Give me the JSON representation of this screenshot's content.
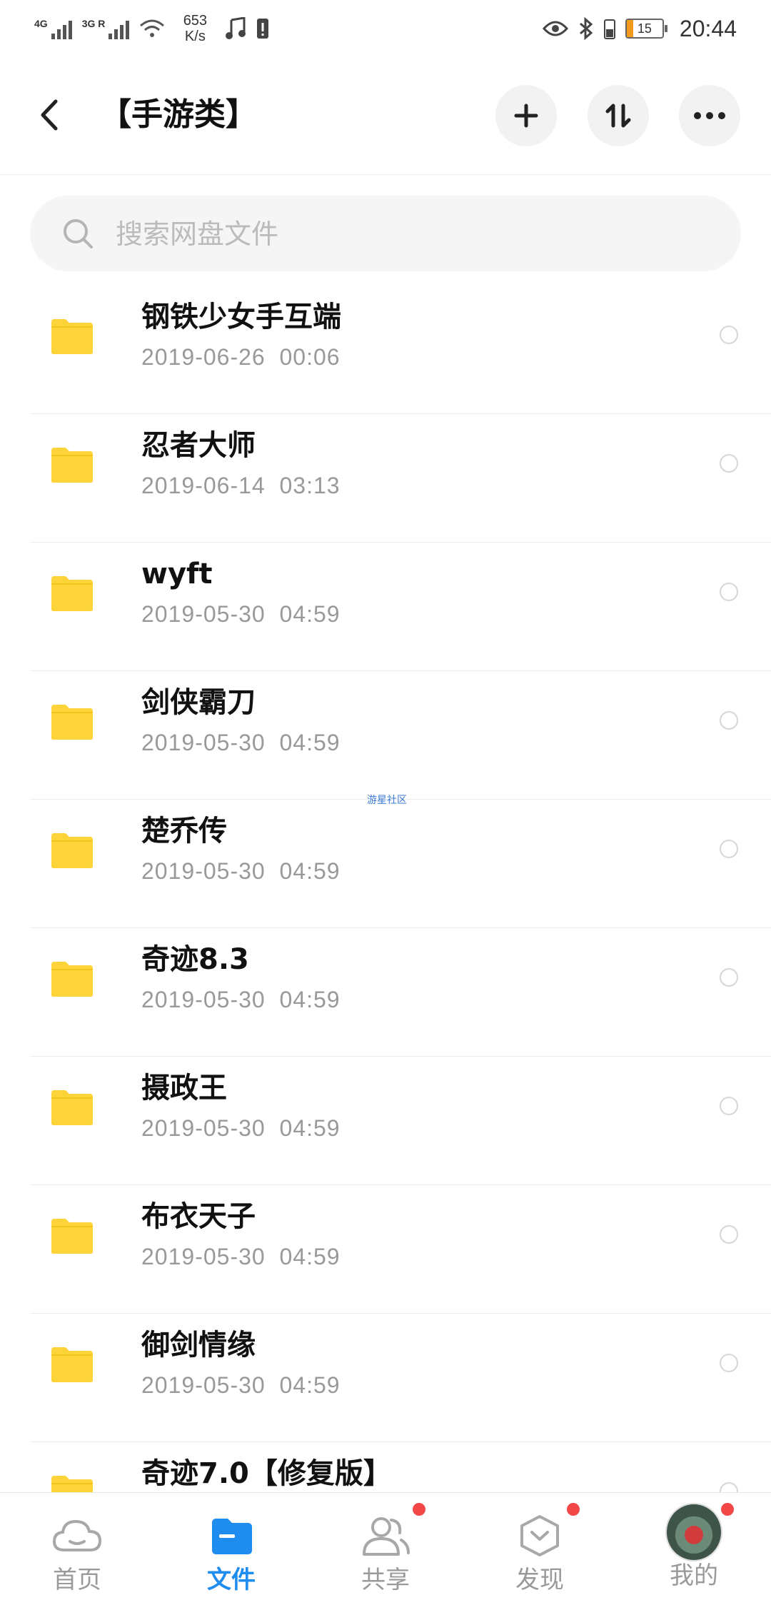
{
  "status_bar": {
    "net1": "4G",
    "net2": "3G R",
    "speed_value": "653",
    "speed_unit": "K/s",
    "battery_level": "15",
    "time": "20:44"
  },
  "header": {
    "title": "【手游类】"
  },
  "search": {
    "placeholder": "搜索网盘文件"
  },
  "files": [
    {
      "name": "钢铁少女手互端",
      "date": "2019-06-26",
      "time": "00:06"
    },
    {
      "name": "忍者大师",
      "date": "2019-06-14",
      "time": "03:13"
    },
    {
      "name": "wyft",
      "date": "2019-05-30",
      "time": "04:59"
    },
    {
      "name": "剑侠霸刀",
      "date": "2019-05-30",
      "time": "04:59"
    },
    {
      "name": "楚乔传",
      "date": "2019-05-30",
      "time": "04:59"
    },
    {
      "name": "奇迹8.3",
      "date": "2019-05-30",
      "time": "04:59"
    },
    {
      "name": "摄政王",
      "date": "2019-05-30",
      "time": "04:59"
    },
    {
      "name": "布衣天子",
      "date": "2019-05-30",
      "time": "04:59"
    },
    {
      "name": "御剑情缘",
      "date": "2019-05-30",
      "time": "04:59"
    },
    {
      "name": "奇迹7.0【修复版】",
      "date": "",
      "time": ""
    }
  ],
  "watermark": "游星社区",
  "colors": {
    "accent": "#1f8cf0",
    "folder": "#fdd33a",
    "badge": "#f44848"
  },
  "nav": [
    {
      "label": "首页",
      "icon": "cloud-icon"
    },
    {
      "label": "文件",
      "icon": "folder-icon",
      "active": true
    },
    {
      "label": "共享",
      "icon": "share-people-icon",
      "badge": true
    },
    {
      "label": "发现",
      "icon": "discover-icon",
      "badge": true
    },
    {
      "label": "我的",
      "icon": "avatar",
      "badge": true
    }
  ]
}
